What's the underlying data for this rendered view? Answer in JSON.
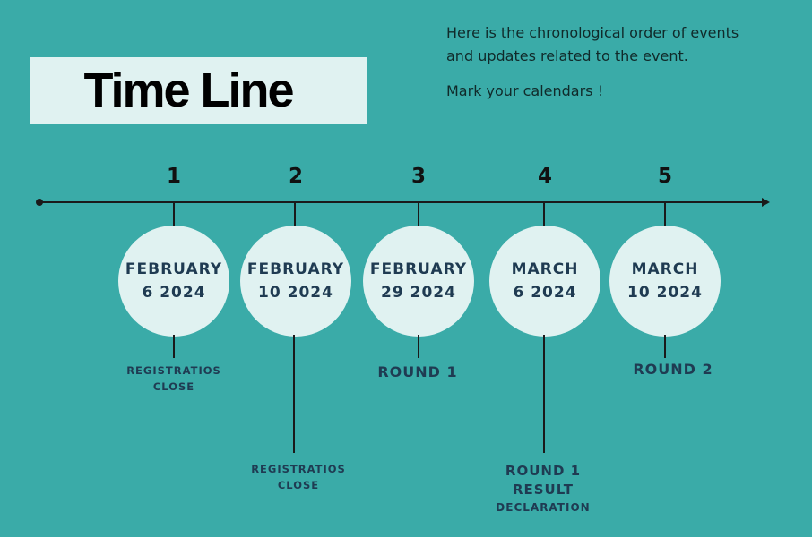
{
  "title": "Time Line",
  "intro": {
    "line1": "Here is the chronological order of events",
    "line2": "and updates related to the event.",
    "line3": "Mark your calendars !"
  },
  "events": [
    {
      "number": "1",
      "date_line1": "FEBRUARY",
      "date_line2": "6 2024",
      "label_line1": "REGISTRATIOS",
      "label_line2": "CLOSE"
    },
    {
      "number": "2",
      "date_line1": "FEBRUARY",
      "date_line2": "10 2024",
      "label_line1": "REGISTRATIOS",
      "label_line2": "CLOSE"
    },
    {
      "number": "3",
      "date_line1": "FEBRUARY",
      "date_line2": "29 2024",
      "label_line1": "ROUND 1"
    },
    {
      "number": "4",
      "date_line1": "MARCH",
      "date_line2": "6 2024",
      "label_line1": "ROUND 1",
      "label_line2": "RESULT",
      "label_line3": "DECLARATION"
    },
    {
      "number": "5",
      "date_line1": "MARCH",
      "date_line2": "10 2024",
      "label_line1": "ROUND 2"
    }
  ]
}
